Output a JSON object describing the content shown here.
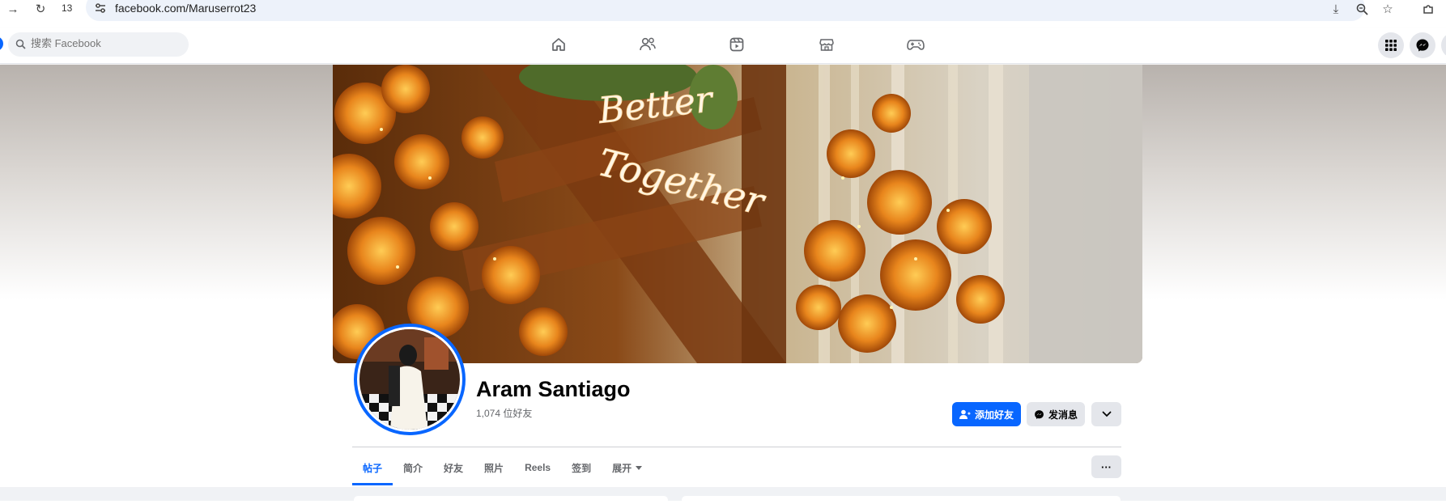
{
  "browser": {
    "tab_count": "13",
    "url": "facebook.com/Maruserrot23"
  },
  "fb_header": {
    "search_placeholder": "搜索 Facebook"
  },
  "profile": {
    "name": "Aram Santiago",
    "friends_count": "1,074 位好友",
    "add_friend_label": "添加好友",
    "message_label": "发消息",
    "cover_neon_line1": "Better",
    "cover_neon_line2": "Together"
  },
  "tabs": [
    {
      "label": "帖子",
      "active": true
    },
    {
      "label": "简介"
    },
    {
      "label": "好友"
    },
    {
      "label": "照片"
    },
    {
      "label": "Reels"
    },
    {
      "label": "签到"
    },
    {
      "label": "展开"
    }
  ],
  "colors": {
    "accent": "#0866ff",
    "secondary_button": "#e4e6eb",
    "muted_text": "#65676b"
  }
}
